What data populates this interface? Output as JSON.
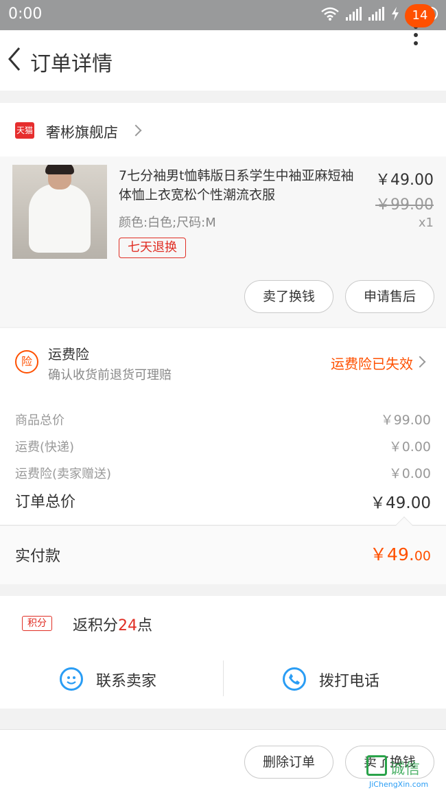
{
  "status_bar": {
    "time": "0:00"
  },
  "nav": {
    "title": "订单详情",
    "badge_count": "14"
  },
  "shop": {
    "logo_text": "天猫",
    "name": "奢彬旗舰店"
  },
  "product": {
    "title": "7七分袖男t恤韩版日系学生中袖亚麻短袖体恤上衣宽松个性潮流衣服",
    "attributes": "颜色:白色;尺码:M",
    "tag": "七天退换",
    "price": "￥49.00",
    "original_price": "￥99.00",
    "quantity": "x1",
    "buttons": {
      "sell": "卖了换钱",
      "after_sale": "申请售后"
    }
  },
  "insurance": {
    "icon_text": "险",
    "title": "运费险",
    "subtitle": "确认收货前退货可理赔",
    "status": "运费险已失效"
  },
  "summary": {
    "rows": [
      {
        "label": "商品总价",
        "value": "￥99.00"
      },
      {
        "label": "运费(快递)",
        "value": "￥0.00"
      },
      {
        "label": "运费险(卖家赠送)",
        "value": "￥0.00"
      }
    ],
    "total_label": "订单总价",
    "total_value": "￥49.00"
  },
  "payment": {
    "label": "实付款",
    "value_main": "￥49.",
    "value_cents": "00"
  },
  "points": {
    "tag": "积分",
    "prefix": "返积分",
    "count": "24",
    "suffix": "点"
  },
  "contact": {
    "seller": "联系卖家",
    "phone": "拨打电话"
  },
  "footer": {
    "delete": "删除订单",
    "sell": "卖了换钱"
  },
  "watermark": {
    "text": "诚信",
    "url": "JiChengXin.com"
  },
  "colors": {
    "accent": "#ff5000",
    "red": "#e02e24",
    "blue": "#2a9df4"
  }
}
